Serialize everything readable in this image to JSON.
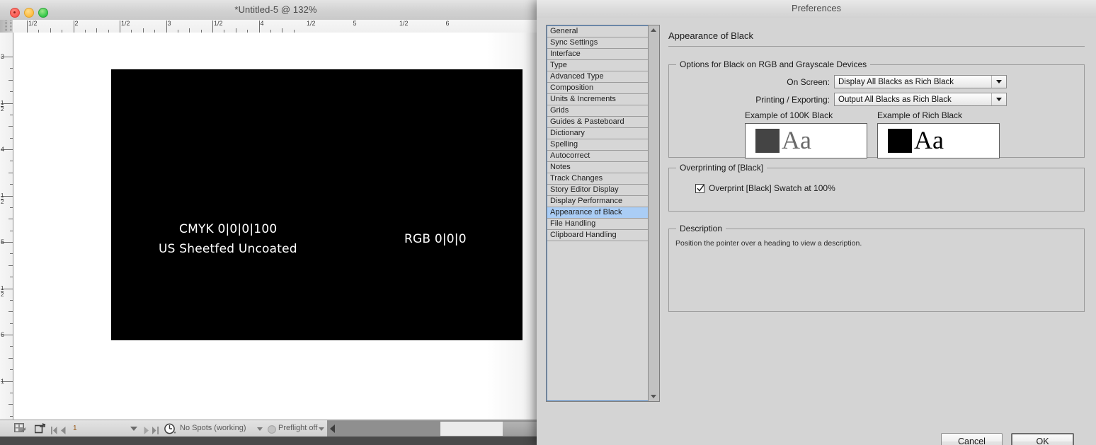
{
  "document_window": {
    "title": "*Untitled-5 @ 132%",
    "traffic_lights": [
      "close",
      "minimize",
      "maximize"
    ],
    "ruler_horizontal": {
      "unit": "inches",
      "labels": [
        "1/2",
        "2",
        "1/2",
        "3",
        "1/2",
        "4",
        "1/2",
        "5",
        "1/2",
        "6"
      ]
    },
    "ruler_vertical": {
      "unit": "inches",
      "labels": [
        "3",
        "1/2",
        "4",
        "1/2",
        "5",
        "1/2",
        "6",
        "1"
      ]
    },
    "canvas": {
      "black_rect_color": "#000000",
      "text_items": [
        {
          "text": "CMYK 0|0|0|100",
          "color": "#ffffff"
        },
        {
          "text": "US Sheetfed Uncoated",
          "color": "#ffffff"
        },
        {
          "text": "RGB 0|0|0",
          "color": "#ffffff"
        }
      ]
    },
    "status_bar": {
      "page_number": "1",
      "page_number_color": "#9a5a18",
      "spots_status": "No Spots (working)",
      "preflight_status": "Preflight off"
    }
  },
  "preferences_dialog": {
    "title": "Preferences",
    "categories": [
      {
        "label": "General",
        "selected": false
      },
      {
        "label": "Sync Settings",
        "selected": false
      },
      {
        "label": "Interface",
        "selected": false
      },
      {
        "label": "Type",
        "selected": false
      },
      {
        "label": "Advanced Type",
        "selected": false
      },
      {
        "label": "Composition",
        "selected": false
      },
      {
        "label": "Units & Increments",
        "selected": false
      },
      {
        "label": "Grids",
        "selected": false
      },
      {
        "label": "Guides & Pasteboard",
        "selected": false
      },
      {
        "label": "Dictionary",
        "selected": false
      },
      {
        "label": "Spelling",
        "selected": false
      },
      {
        "label": "Autocorrect",
        "selected": false
      },
      {
        "label": "Notes",
        "selected": false
      },
      {
        "label": "Track Changes",
        "selected": false
      },
      {
        "label": "Story Editor Display",
        "selected": false
      },
      {
        "label": "Display Performance",
        "selected": false
      },
      {
        "label": "Appearance of Black",
        "selected": true
      },
      {
        "label": "File Handling",
        "selected": false
      },
      {
        "label": "Clipboard Handling",
        "selected": false
      }
    ],
    "selection_color": "#aacdf5",
    "pane_heading": "Appearance of Black",
    "options_group": {
      "legend": "Options for Black on RGB and Grayscale Devices",
      "on_screen_label": "On Screen:",
      "on_screen_value": "Display All Blacks as Rich Black",
      "printing_label": "Printing / Exporting:",
      "printing_value": "Output All Blacks as Rich Black",
      "example_100k_label": "Example of 100K Black",
      "example_100k_swatch_color": "#444444",
      "example_100k_text": "Aa",
      "example_100k_text_color": "#6a6a6a",
      "example_rich_label": "Example of Rich Black",
      "example_rich_swatch_color": "#000000",
      "example_rich_text": "Aa",
      "example_rich_text_color": "#000000"
    },
    "overprint_group": {
      "legend": "Overprinting of [Black]",
      "checkbox_label": "Overprint [Black] Swatch at 100%",
      "checked": true
    },
    "description_group": {
      "legend": "Description",
      "text": "Position the pointer over a heading to view a description."
    },
    "buttons": {
      "cancel": "Cancel",
      "ok": "OK"
    }
  }
}
